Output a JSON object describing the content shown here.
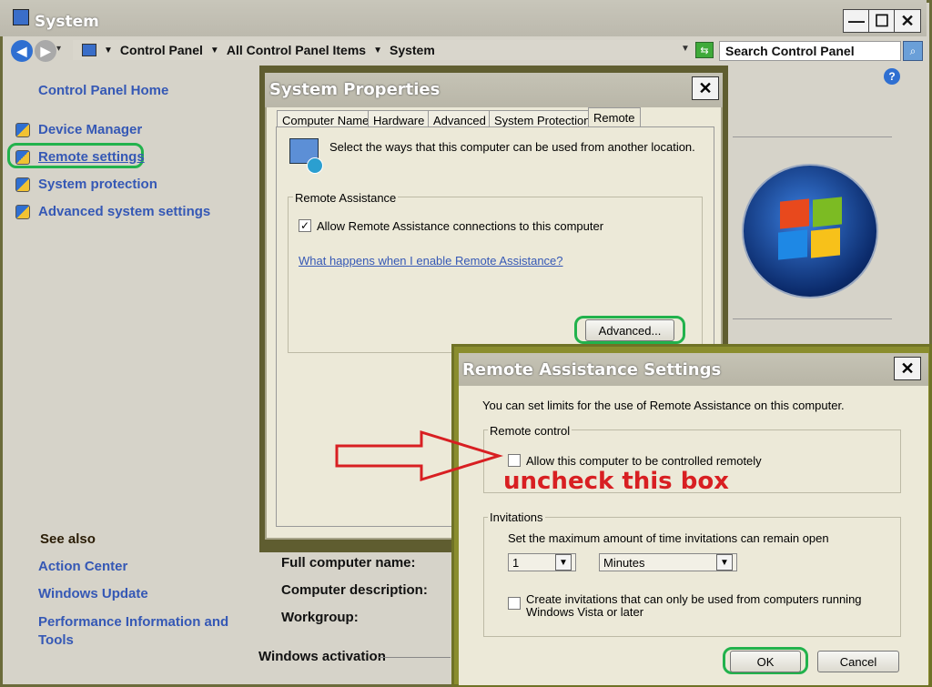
{
  "window": {
    "title": "System",
    "minimize": "—",
    "maximize": "☐",
    "close": "✕"
  },
  "address_bar": {
    "crumbs": [
      "Control Panel",
      "All Control Panel Items",
      "System"
    ],
    "search_placeholder": "Search Control Panel"
  },
  "left_nav": {
    "home": "Control Panel Home",
    "items": [
      "Device Manager",
      "Remote settings",
      "System protection",
      "Advanced system settings"
    ],
    "see_also_header": "See also",
    "see_also": [
      "Action Center",
      "Windows Update",
      "Performance Information and Tools"
    ]
  },
  "main_content": {
    "labels": [
      "Full computer name:",
      "Computer description:",
      "Workgroup:"
    ],
    "activation_header": "Windows activation"
  },
  "system_properties": {
    "title": "System Properties",
    "tabs": [
      "Computer Name",
      "Hardware",
      "Advanced",
      "System Protection",
      "Remote"
    ],
    "active_tab": "Remote",
    "intro": "Select the ways that this computer can be used from another location.",
    "remote_assistance_group": "Remote Assistance",
    "allow_ra_label": "Allow Remote Assistance connections to this computer",
    "allow_ra_checked": true,
    "what_happens_link": "What happens when I enable Remote Assistance?",
    "advanced_button": "Advanced..."
  },
  "remote_assistance_settings": {
    "title": "Remote Assistance Settings",
    "intro": "You can set limits for the use of Remote Assistance on this computer.",
    "remote_control_group": "Remote control",
    "allow_control_label": "Allow this computer to be controlled remotely",
    "allow_control_checked": false,
    "invitations_group": "Invitations",
    "invitations_desc": "Set the maximum amount of time invitations can remain open",
    "duration_value": "1",
    "duration_unit": "Minutes",
    "vista_only_label_1": "Create invitations that can only be used from computers running",
    "vista_only_label_2": "Windows Vista or later",
    "vista_only_checked": false,
    "ok_button": "OK",
    "cancel_button": "Cancel"
  },
  "annotation": {
    "text": "uncheck this box",
    "color": "#d81f22",
    "highlight_color": "#22b24c"
  }
}
